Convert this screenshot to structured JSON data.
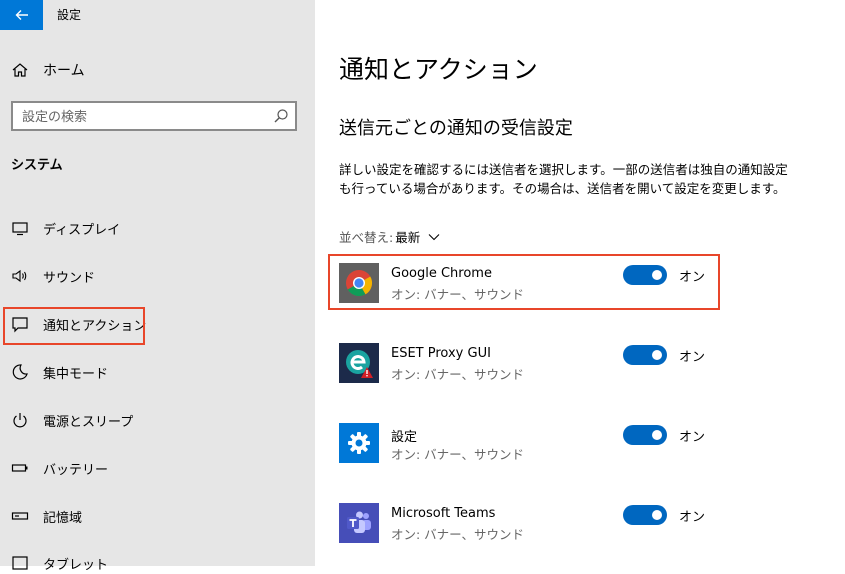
{
  "window": {
    "title": "設定"
  },
  "sidebar": {
    "home_label": "ホーム",
    "search_placeholder": "設定の検索",
    "section_heading": "システム",
    "items": [
      {
        "label": "ディスプレイ",
        "icon": "monitor-icon"
      },
      {
        "label": "サウンド",
        "icon": "speaker-icon"
      },
      {
        "label": "通知とアクション",
        "icon": "notification-icon",
        "selected": true
      },
      {
        "label": "集中モード",
        "icon": "moon-icon"
      },
      {
        "label": "電源とスリープ",
        "icon": "power-icon"
      },
      {
        "label": "バッテリー",
        "icon": "battery-icon"
      },
      {
        "label": "記憶域",
        "icon": "storage-icon"
      },
      {
        "label": "タブレット",
        "icon": "tablet-icon"
      }
    ]
  },
  "main": {
    "title": "通知とアクション",
    "subtitle": "送信元ごとの通知の受信設定",
    "description": "詳しい設定を確認するには送信者を選択します。一部の送信者は独自の通知設定も行っている場合があります。その場合は、送信者を開いて設定を変更します。",
    "sort_label": "並べ替え:",
    "sort_value": "最新",
    "apps": [
      {
        "name": "Google Chrome",
        "status": "オン: バナー、サウンド",
        "toggle_label": "オン",
        "on": true,
        "icon": "chrome-icon"
      },
      {
        "name": "ESET Proxy GUI",
        "status": "オン: バナー、サウンド",
        "toggle_label": "オン",
        "on": true,
        "icon": "eset-icon"
      },
      {
        "name": "設定",
        "status": "オン: バナー、サウンド",
        "toggle_label": "オン",
        "on": true,
        "icon": "settings-gear-icon"
      },
      {
        "name": "Microsoft Teams",
        "status": "オン: バナー、サウンド",
        "toggle_label": "オン",
        "on": true,
        "icon": "teams-icon"
      }
    ]
  },
  "colors": {
    "accent": "#0067c0",
    "highlight": "#e8462a",
    "sidebar_bg": "#e6e6e6"
  }
}
